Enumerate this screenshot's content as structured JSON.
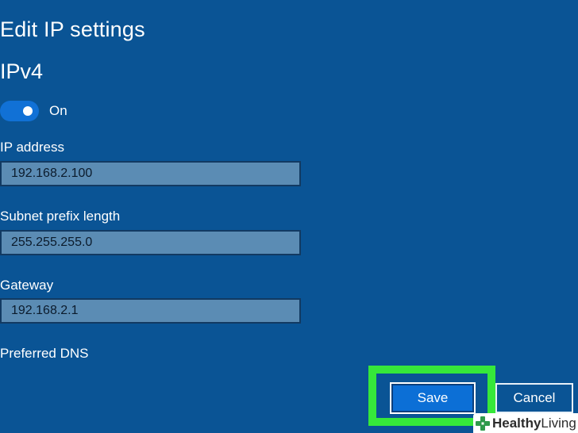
{
  "header": {
    "title": "Edit IP settings"
  },
  "ipv4": {
    "section_title": "IPv4",
    "toggle_label": "On",
    "toggle_state": "on"
  },
  "fields": {
    "ip_address": {
      "label": "IP address",
      "value": "192.168.2.100"
    },
    "subnet": {
      "label": "Subnet prefix length",
      "value": "255.255.255.0"
    },
    "gateway": {
      "label": "Gateway",
      "value": "192.168.2.1"
    },
    "preferred_dns": {
      "label": "Preferred DNS"
    }
  },
  "actions": {
    "save_label": "Save",
    "cancel_label": "Cancel"
  },
  "watermark": {
    "brand_bold": "Healthy",
    "brand_rest": " Living"
  },
  "colors": {
    "background": "#0a5495",
    "accent": "#1171d6",
    "input_fill": "#5b8cb4",
    "highlight": "#36e83a"
  },
  "icons": {
    "watermark": "cross-logo-icon"
  }
}
